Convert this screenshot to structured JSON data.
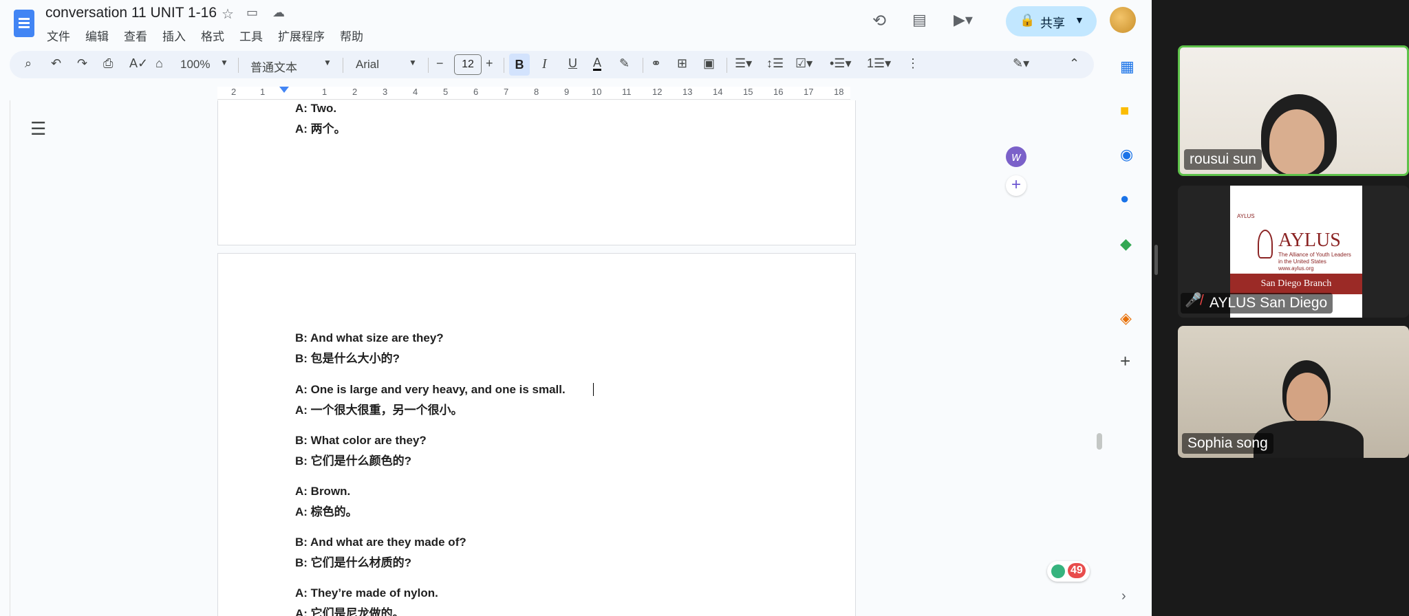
{
  "doc": {
    "title": "conversation 11 UNIT 1-16",
    "menu": [
      "文件",
      "编辑",
      "查看",
      "插入",
      "格式",
      "工具",
      "扩展程序",
      "帮助"
    ],
    "share_label": "共享"
  },
  "toolbar": {
    "zoom": "100%",
    "style": "普通文本",
    "font": "Arial",
    "font_size": "12",
    "bold": "B",
    "italic": "I",
    "underline": "U",
    "text_color": "A"
  },
  "ruler": {
    "ticks": [
      "2",
      "1",
      "1",
      "2",
      "3",
      "4",
      "5",
      "6",
      "7",
      "8",
      "9",
      "10",
      "11",
      "12",
      "13",
      "14",
      "15",
      "16",
      "17",
      "18"
    ]
  },
  "page1": {
    "lines": [
      "A: Two.",
      "A: 两个。"
    ]
  },
  "page2": {
    "lines": [
      "B: And what size are they?",
      "B: 包是什么大小的?",
      "A: One is large and very heavy, and one is small.",
      "A: 一个很大很重，另一个很小。",
      "B: What color are they?",
      "B: 它们是什么颜色的?",
      "A: Brown.",
      "A: 棕色的。",
      "B: And what are they made of?",
      "B: 它们是什么材质的?",
      "A: They’re made of nylon.",
      "A: 它们是尼龙做的。"
    ]
  },
  "badge": {
    "count": "49"
  },
  "meeting": {
    "participants": [
      {
        "name": "rousui sun",
        "active_speaker": true
      },
      {
        "name": "AYLUS San Diego",
        "muted": true
      },
      {
        "name": "Sophia song"
      }
    ],
    "aylus_card": {
      "small_text": "AYLUS",
      "name": "AYLUS",
      "tagline": "The Alliance of Youth Leaders in the United States",
      "url": "www.aylus.org",
      "branch": "San Diego Branch"
    }
  },
  "colors": {
    "accent_blue": "#4285f4",
    "share_bg": "#c2e7ff",
    "active_speaker_border": "#5ec24a",
    "aylus_red": "#9b2a26"
  }
}
